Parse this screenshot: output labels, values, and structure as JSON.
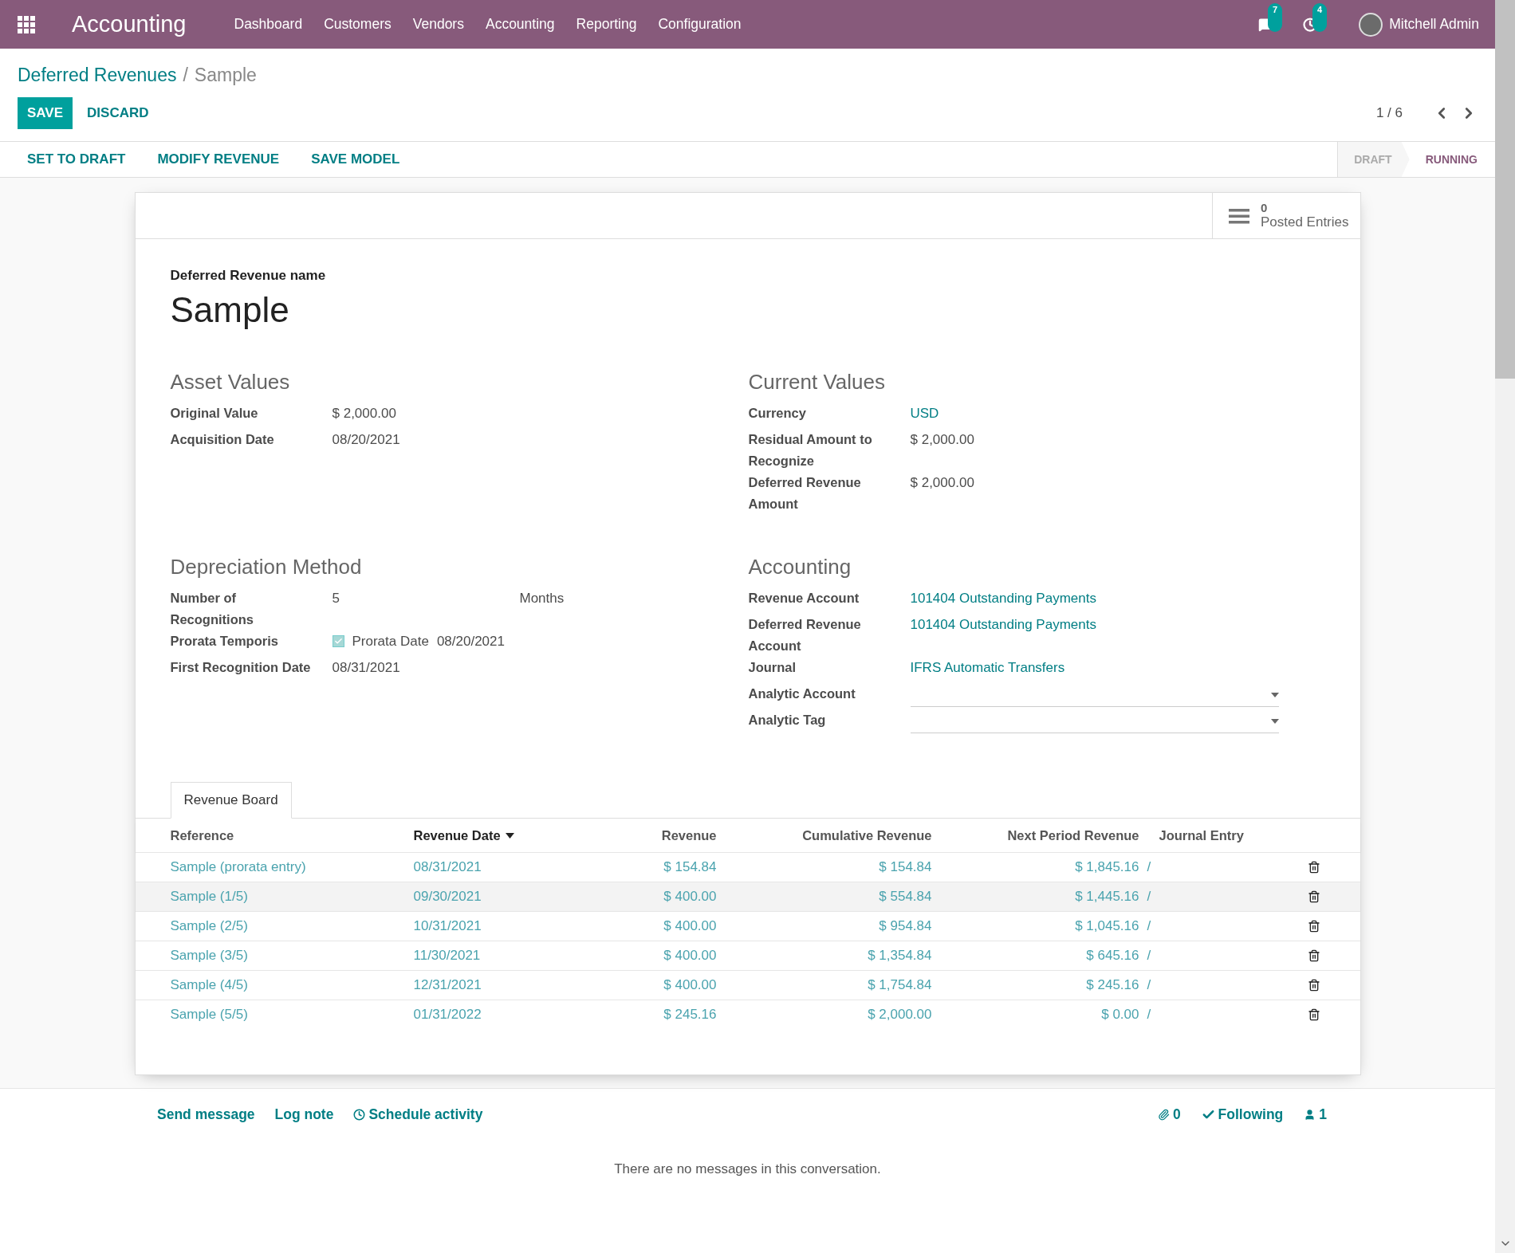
{
  "navbar": {
    "app_name": "Accounting",
    "menu": [
      "Dashboard",
      "Customers",
      "Vendors",
      "Accounting",
      "Reporting",
      "Configuration"
    ],
    "messages_count": "7",
    "activities_count": "4",
    "user": "Mitchell Admin"
  },
  "breadcrumb": [
    "Deferred Revenues",
    "Sample"
  ],
  "breadcrumb_separator": "/",
  "buttons": [
    {
      "label": "SAVE",
      "kind": "primary"
    },
    {
      "label": "DISCARD",
      "kind": "secondary"
    }
  ],
  "pager": "1 / 6",
  "actions": [
    "SET TO DRAFT",
    "MODIFY REVENUE",
    "SAVE MODEL"
  ],
  "statuses": [
    {
      "label": "DRAFT",
      "selected": false
    },
    {
      "label": "RUNNING",
      "selected": true
    }
  ],
  "stat_button": {
    "value": "0",
    "label": "Posted Entries"
  },
  "name_label": "Deferred Revenue name",
  "name": "Sample",
  "groups": [
    {
      "title": "Asset Values",
      "fields": [
        {
          "label": "Original Value",
          "kind": "text",
          "value": "$ 2,000.00"
        },
        {
          "label": "Acquisition Date",
          "kind": "text",
          "value": "08/20/2021"
        }
      ]
    },
    {
      "title": "Current Values",
      "fields": [
        {
          "label": "Currency",
          "kind": "link",
          "value": "USD"
        },
        {
          "label": "Residual Amount to Recognize",
          "kind": "text",
          "value": "$ 2,000.00"
        },
        {
          "label": "Deferred Revenue Amount",
          "kind": "text",
          "value": "$ 2,000.00"
        }
      ]
    },
    {
      "title": "Depreciation Method",
      "fields": [
        {
          "label": "Number of Recognitions",
          "kind": "number_unit",
          "value": "5",
          "unit": "Months"
        },
        {
          "label": "Prorata Temporis",
          "kind": "checkbox",
          "checked": true,
          "extra_label": "Prorata Date",
          "value": "08/20/2021"
        },
        {
          "label": "First Recognition Date",
          "kind": "text",
          "value": "08/31/2021"
        }
      ]
    },
    {
      "title": "Accounting",
      "fields": [
        {
          "label": "Revenue Account",
          "kind": "link",
          "value": "101404 Outstanding Payments"
        },
        {
          "label": "Deferred Revenue Account",
          "kind": "link",
          "value": "101404 Outstanding Payments"
        },
        {
          "label": "Journal",
          "kind": "link",
          "value": "IFRS Automatic Transfers"
        },
        {
          "label": "Analytic Account",
          "kind": "dropdown"
        },
        {
          "label": "Analytic Tag",
          "kind": "dropdown"
        }
      ]
    }
  ],
  "tabs": [
    {
      "label": "Revenue Board",
      "selected": true
    }
  ],
  "table": {
    "columns": [
      {
        "label": "Reference",
        "sorted": false
      },
      {
        "label": "Revenue Date",
        "sorted": true
      },
      {
        "label": "Revenue",
        "sorted": false
      },
      {
        "label": "Cumulative Revenue",
        "sorted": false
      },
      {
        "label": "Next Period Revenue",
        "sorted": false
      },
      {
        "label": "Journal Entry",
        "sorted": false
      }
    ],
    "rows": [
      {
        "cells": [
          "Sample (prorata entry)",
          "08/31/2021",
          "$ 154.84",
          "$ 154.84",
          "$ 1,845.16",
          "/"
        ],
        "highlighted": false
      },
      {
        "cells": [
          "Sample (1/5)",
          "09/30/2021",
          "$ 400.00",
          "$ 554.84",
          "$ 1,445.16",
          "/"
        ],
        "highlighted": true
      },
      {
        "cells": [
          "Sample (2/5)",
          "10/31/2021",
          "$ 400.00",
          "$ 954.84",
          "$ 1,045.16",
          "/"
        ],
        "highlighted": false
      },
      {
        "cells": [
          "Sample (3/5)",
          "11/30/2021",
          "$ 400.00",
          "$ 1,354.84",
          "$ 645.16",
          "/"
        ],
        "highlighted": false
      },
      {
        "cells": [
          "Sample (4/5)",
          "12/31/2021",
          "$ 400.00",
          "$ 1,754.84",
          "$ 245.16",
          "/"
        ],
        "highlighted": false
      },
      {
        "cells": [
          "Sample (5/5)",
          "01/31/2022",
          "$ 245.16",
          "$ 2,000.00",
          "$ 0.00",
          "/"
        ],
        "highlighted": false
      }
    ]
  },
  "chatter": {
    "actions": [
      {
        "label": "Send message",
        "kind": "plain"
      },
      {
        "label": "Log note",
        "kind": "plain"
      },
      {
        "label": "Schedule activity",
        "kind": "clock"
      }
    ],
    "attachments": "0",
    "follow": "Following",
    "followers": "1",
    "empty_message": "There are no messages in this conversation."
  }
}
